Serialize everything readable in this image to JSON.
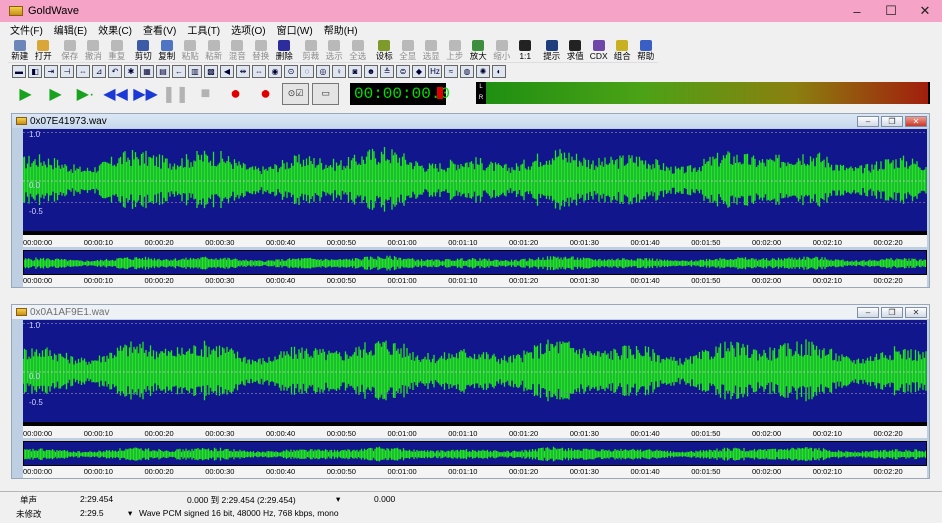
{
  "window": {
    "title": "GoldWave",
    "minimize": "–",
    "maximize": "☐",
    "close": "✕"
  },
  "menu": [
    "文件(F)",
    "编辑(E)",
    "效果(C)",
    "查看(V)",
    "工具(T)",
    "选项(O)",
    "窗口(W)",
    "帮助(H)"
  ],
  "toolbar": [
    {
      "label": "新建",
      "icon": "new-file-icon",
      "color": "#6b86b8",
      "enabled": true
    },
    {
      "label": "打开",
      "icon": "open-folder-icon",
      "color": "#d9a63a",
      "enabled": true
    },
    {
      "label": "保存",
      "icon": "save-icon",
      "color": "#999999",
      "enabled": false
    },
    {
      "label": "撤消",
      "icon": "undo-icon",
      "color": "#999999",
      "enabled": false
    },
    {
      "label": "重复",
      "icon": "redo-icon",
      "color": "#999999",
      "enabled": false
    },
    {
      "label": "剪切",
      "icon": "cut-icon",
      "color": "#3d5aa6",
      "enabled": true
    },
    {
      "label": "复制",
      "icon": "copy-icon",
      "color": "#4f74c4",
      "enabled": true
    },
    {
      "label": "粘贴",
      "icon": "paste-icon",
      "color": "#999999",
      "enabled": false
    },
    {
      "label": "粘新",
      "icon": "paste-new-icon",
      "color": "#999999",
      "enabled": false
    },
    {
      "label": "混音",
      "icon": "mix-icon",
      "color": "#999999",
      "enabled": false
    },
    {
      "label": "替换",
      "icon": "replace-icon",
      "color": "#999999",
      "enabled": false
    },
    {
      "label": "删除",
      "icon": "delete-icon",
      "color": "#2c2c9c",
      "enabled": true
    },
    {
      "label": "剪裁",
      "icon": "trim-icon",
      "color": "#999999",
      "enabled": false
    },
    {
      "label": "选示",
      "icon": "show-selection-icon",
      "color": "#999999",
      "enabled": false
    },
    {
      "label": "全选",
      "icon": "select-all-icon",
      "color": "#999999",
      "enabled": false
    },
    {
      "label": "设标",
      "icon": "set-marker-icon",
      "color": "#7d9a2a",
      "enabled": true
    },
    {
      "label": "全显",
      "icon": "zoom-all-icon",
      "color": "#999999",
      "enabled": false
    },
    {
      "label": "选显",
      "icon": "zoom-selection-icon",
      "color": "#999999",
      "enabled": false
    },
    {
      "label": "上步",
      "icon": "previous-zoom-icon",
      "color": "#999999",
      "enabled": false
    },
    {
      "label": "放大",
      "icon": "zoom-in-icon",
      "color": "#3d8f3d",
      "enabled": true
    },
    {
      "label": "缩小",
      "icon": "zoom-out-icon",
      "color": "#999999",
      "enabled": false
    },
    {
      "label": "1:1",
      "icon": "zoom-1-1-icon",
      "color": "#222222",
      "enabled": true
    },
    {
      "label": "提示",
      "icon": "cue-icon",
      "color": "#1d3d7c",
      "enabled": true
    },
    {
      "label": "求值",
      "icon": "evaluate-icon",
      "color": "#222222",
      "enabled": true
    },
    {
      "label": "CDX",
      "icon": "cd-extract-icon",
      "color": "#6d48a8",
      "enabled": true
    },
    {
      "label": "组合",
      "icon": "combine-icon",
      "color": "#c8b020",
      "enabled": true
    },
    {
      "label": "帮助",
      "icon": "help-icon",
      "color": "#3a5fc4",
      "enabled": true
    }
  ],
  "toolbar2": [
    "▬",
    "◧",
    "⇥",
    "⊣",
    "⇔",
    "⊿",
    "↶",
    "✱",
    "▦",
    "▤",
    "←",
    "▥",
    "▩",
    "◀",
    "⇹",
    "⇔",
    "◉",
    "⊙",
    "◌",
    "◎",
    "♀",
    "◙",
    "☻",
    "≙",
    "⊜",
    "◆",
    "Hz",
    "≈",
    "◍",
    "✺",
    "◐"
  ],
  "transport": {
    "play": "▶",
    "play_selection": "▶",
    "play_from": "▶·",
    "rewind": "◀◀",
    "fast_forward": "▶▶",
    "pause": "❚❚",
    "stop": "■",
    "record": "●",
    "record_selection": "●",
    "options": "⊙☑",
    "monitor": "▭"
  },
  "counter": "00:00:00.0",
  "meter": {
    "left_label": "L",
    "right_label": "R"
  },
  "wave_windows": [
    {
      "title": "0x07E41973.wav",
      "active": true,
      "amp_top": "1.0",
      "amp_mid": "0.0",
      "amp_low": "-0.5"
    },
    {
      "title": "0x0A1AF9E1.wav",
      "active": false,
      "amp_top": "1.0",
      "amp_mid": "0.0",
      "amp_low": "-0.5"
    }
  ],
  "time_ticks": [
    "00:00:00",
    "00:00:10",
    "00:00:20",
    "00:00:30",
    "00:00:40",
    "00:00:50",
    "00:01:00",
    "00:01:10",
    "00:01:20",
    "00:01:30",
    "00:01:40",
    "00:01:50",
    "00:02:00",
    "00:02:10",
    "00:02:20"
  ],
  "overview_ticks": [
    "00:00:00",
    "00:00:10",
    "00:00:20",
    "00:00:30",
    "00:00:40",
    "00:00:50",
    "00:01:00",
    "00:01:10",
    "00:01:20",
    "00:01:30",
    "00:01:40",
    "00:01:50",
    "00:02:00",
    "00:02:10",
    "00:02:20"
  ],
  "status": {
    "channel": "单声",
    "length": "2:29.454",
    "selection": "0.000 到 2:29.454 (2:29.454)",
    "selection_arrow": "▾",
    "position": "0.000",
    "modified": "未修改",
    "modified_time": "2:29.5",
    "format": "Wave PCM signed 16 bit, 48000 Hz, 768 kbps, mono",
    "format_arrow": "▾"
  },
  "colors": {
    "titlebar": "#f5a3c6",
    "wave_bg": "#12168c",
    "wave_fg": "#22e61e",
    "counter_text": "#00e000"
  }
}
